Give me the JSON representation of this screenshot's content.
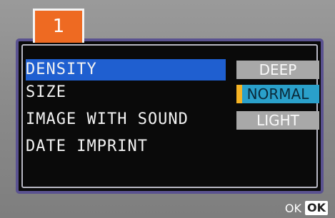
{
  "tab": {
    "label": "1"
  },
  "menu": {
    "items": [
      {
        "label": "DENSITY",
        "selected": true
      },
      {
        "label": "SIZE",
        "selected": false
      },
      {
        "label": "IMAGE WITH SOUND",
        "selected": false
      },
      {
        "label": "DATE IMPRINT",
        "selected": false
      }
    ]
  },
  "options": {
    "items": [
      {
        "label": "DEEP",
        "selected": false
      },
      {
        "label": "NORMAL",
        "selected": true
      },
      {
        "label": "LIGHT",
        "selected": false
      }
    ]
  },
  "footer": {
    "ok_text": "OK",
    "ok_key": "OK"
  },
  "colors": {
    "tab": "#ee6a22",
    "menu_highlight": "#1f5fd0",
    "option_selected": "#2aa0ca",
    "option_marker": "#f5b324",
    "option_normal": "#a8a8a8",
    "panel_border": "#5a5290"
  }
}
